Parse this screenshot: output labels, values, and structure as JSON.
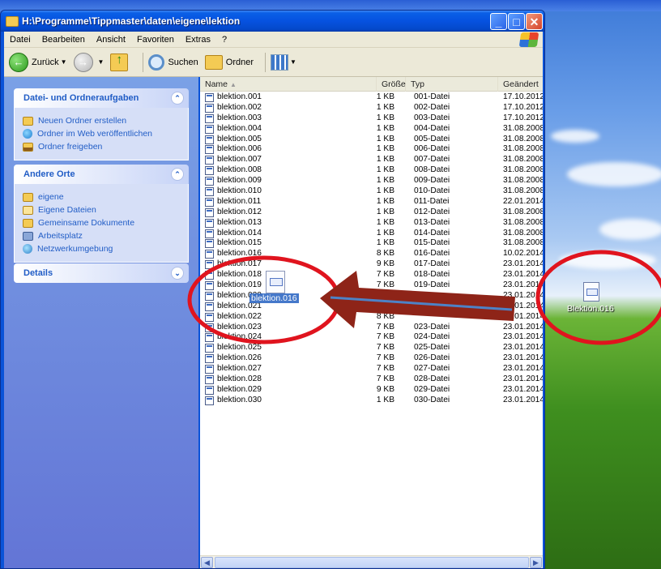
{
  "window": {
    "title": "H:\\Programme\\Tippmaster\\daten\\eigene\\lektion",
    "caption_buttons": {
      "minimize": "_",
      "maximize": "□",
      "close": "✕"
    }
  },
  "menu": [
    "Datei",
    "Bearbeiten",
    "Ansicht",
    "Favoriten",
    "Extras",
    "?"
  ],
  "toolbar": {
    "back_label": "Zurück",
    "search_label": "Suchen",
    "folders_label": "Ordner"
  },
  "taskpane": {
    "file_tasks": {
      "title": "Datei- und Ordneraufgaben",
      "items": [
        "Neuen Ordner erstellen",
        "Ordner im Web veröffentlichen",
        "Ordner freigeben"
      ]
    },
    "other_places": {
      "title": "Andere Orte",
      "items": [
        "eigene",
        "Eigene Dateien",
        "Gemeinsame Dokumente",
        "Arbeitsplatz",
        "Netzwerkumgebung"
      ]
    },
    "details": {
      "title": "Details"
    }
  },
  "filelist": {
    "columns": {
      "name": "Name",
      "size": "Größe",
      "type": "Typ",
      "date": "Geändert"
    },
    "rows": [
      {
        "name": "blektion.001",
        "size": "1 KB",
        "type": "001-Datei",
        "date": "17.10.2012"
      },
      {
        "name": "blektion.002",
        "size": "1 KB",
        "type": "002-Datei",
        "date": "17.10.2012"
      },
      {
        "name": "blektion.003",
        "size": "1 KB",
        "type": "003-Datei",
        "date": "17.10.2012"
      },
      {
        "name": "blektion.004",
        "size": "1 KB",
        "type": "004-Datei",
        "date": "31.08.2008"
      },
      {
        "name": "blektion.005",
        "size": "1 KB",
        "type": "005-Datei",
        "date": "31.08.2008"
      },
      {
        "name": "blektion.006",
        "size": "1 KB",
        "type": "006-Datei",
        "date": "31.08.2008"
      },
      {
        "name": "blektion.007",
        "size": "1 KB",
        "type": "007-Datei",
        "date": "31.08.2008"
      },
      {
        "name": "blektion.008",
        "size": "1 KB",
        "type": "008-Datei",
        "date": "31.08.2008"
      },
      {
        "name": "blektion.009",
        "size": "1 KB",
        "type": "009-Datei",
        "date": "31.08.2008"
      },
      {
        "name": "blektion.010",
        "size": "1 KB",
        "type": "010-Datei",
        "date": "31.08.2008"
      },
      {
        "name": "blektion.011",
        "size": "1 KB",
        "type": "011-Datei",
        "date": "22.01.2014"
      },
      {
        "name": "blektion.012",
        "size": "1 KB",
        "type": "012-Datei",
        "date": "31.08.2008"
      },
      {
        "name": "blektion.013",
        "size": "1 KB",
        "type": "013-Datei",
        "date": "31.08.2008"
      },
      {
        "name": "blektion.014",
        "size": "1 KB",
        "type": "014-Datei",
        "date": "31.08.2008"
      },
      {
        "name": "blektion.015",
        "size": "1 KB",
        "type": "015-Datei",
        "date": "31.08.2008"
      },
      {
        "name": "blektion.016",
        "size": "8 KB",
        "type": "016-Datei",
        "date": "10.02.2014"
      },
      {
        "name": "blektion.017",
        "size": "9 KB",
        "type": "017-Datei",
        "date": "23.01.2014"
      },
      {
        "name": "blektion.018",
        "size": "7 KB",
        "type": "018-Datei",
        "date": "23.01.2014"
      },
      {
        "name": "blektion.019",
        "size": "7 KB",
        "type": "019-Datei",
        "date": "23.01.2014"
      },
      {
        "name": "blektion.020",
        "size": "",
        "type": "",
        "date": "23.01.2014"
      },
      {
        "name": "blektion.021",
        "size": "",
        "type": "",
        "date": "23.01.2014"
      },
      {
        "name": "blektion.022",
        "size": "8 KB",
        "type": "",
        "date": "23.01.2014"
      },
      {
        "name": "blektion.023",
        "size": "7 KB",
        "type": "023-Datei",
        "date": "23.01.2014"
      },
      {
        "name": "blektion.024",
        "size": "7 KB",
        "type": "024-Datei",
        "date": "23.01.2014"
      },
      {
        "name": "blektion.025",
        "size": "7 KB",
        "type": "025-Datei",
        "date": "23.01.2014"
      },
      {
        "name": "blektion.026",
        "size": "7 KB",
        "type": "026-Datei",
        "date": "23.01.2014"
      },
      {
        "name": "blektion.027",
        "size": "7 KB",
        "type": "027-Datei",
        "date": "23.01.2014"
      },
      {
        "name": "blektion.028",
        "size": "7 KB",
        "type": "028-Datei",
        "date": "23.01.2014"
      },
      {
        "name": "blektion.029",
        "size": "9 KB",
        "type": "029-Datei",
        "date": "23.01.2014"
      },
      {
        "name": "blektion.030",
        "size": "1 KB",
        "type": "030-Datei",
        "date": "23.01.2014"
      }
    ]
  },
  "drag": {
    "label": "blektion.016"
  },
  "desktop": {
    "icon_label": "Blektion.016"
  },
  "colors": {
    "xp_blue": "#0a53d8",
    "task_link": "#215dc6",
    "selection": "#316ac5",
    "annotation_red": "#e0141e",
    "arrow_fill": "#8e2418",
    "arrow_line": "#4d82c6"
  },
  "icons": {
    "back": "arrow-left-icon",
    "forward": "arrow-right-icon",
    "up": "folder-up-icon",
    "search": "search-icon",
    "folders": "folder-icon",
    "views": "view-grid-icon"
  }
}
